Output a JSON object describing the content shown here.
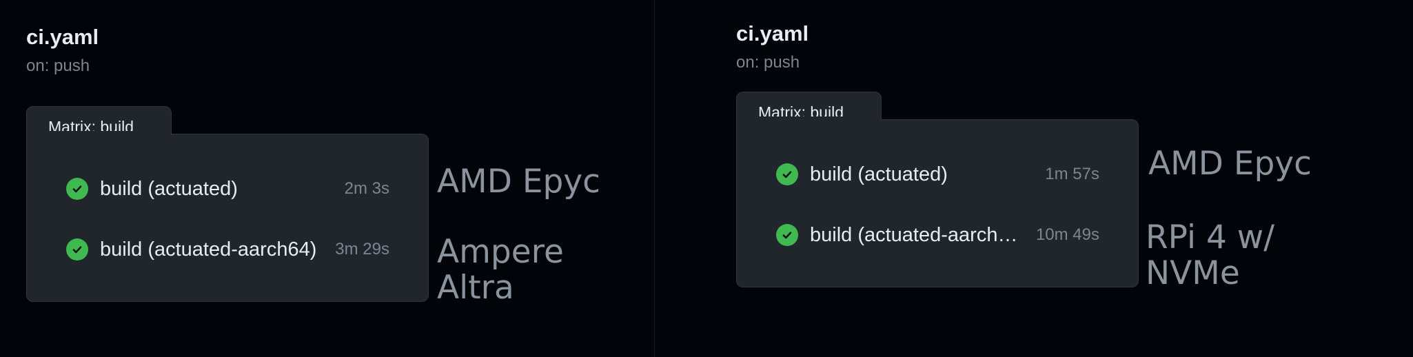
{
  "left": {
    "workflow_title": "ci.yaml",
    "trigger": "on: push",
    "matrix_label": "Matrix: build",
    "jobs": [
      {
        "name": "build (actuated)",
        "duration": "2m 3s",
        "status": "success"
      },
      {
        "name": "build (actuated-aarch64)",
        "duration": "3m 29s",
        "status": "success"
      }
    ],
    "annotations": [
      "AMD Epyc",
      "Ampere Altra"
    ]
  },
  "right": {
    "workflow_title": "ci.yaml",
    "trigger": "on: push",
    "matrix_label": "Matrix: build",
    "jobs": [
      {
        "name": "build (actuated)",
        "duration": "1m 57s",
        "status": "success"
      },
      {
        "name": "build (actuated-aarch…",
        "duration": "10m 49s",
        "status": "success"
      }
    ],
    "annotations": [
      "AMD Epyc",
      "RPi 4 w/ NVMe"
    ]
  },
  "icons": {
    "job_status": "check-circle-icon"
  },
  "colors": {
    "background": "#010409",
    "card": "#21262d",
    "border": "#30363d",
    "success": "#3fb950",
    "text_primary": "#e6edf3",
    "text_muted": "#7d8590",
    "annotation": "#8b949e"
  }
}
